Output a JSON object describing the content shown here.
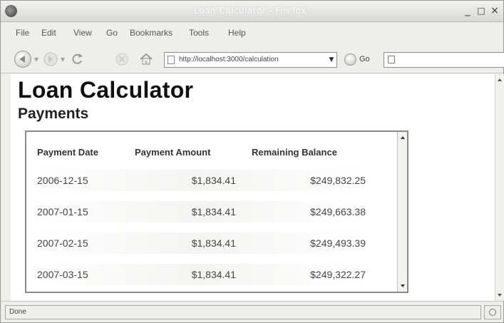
{
  "window": {
    "title": "Loan Calculator - Firefox",
    "controls": {
      "minimize": "_",
      "maximize": "□",
      "close": "×"
    }
  },
  "menu": {
    "items": [
      {
        "label": "File"
      },
      {
        "label": "Edit"
      },
      {
        "label": "View"
      },
      {
        "label": "Go"
      },
      {
        "label": "Bookmarks"
      },
      {
        "label": "Tools"
      },
      {
        "label": "Help"
      }
    ]
  },
  "toolbar": {
    "url": "http://localhost:3000/calculation",
    "go_label": "Go",
    "search_value": ""
  },
  "page": {
    "title": "Loan Calculator",
    "section_title": "Payments"
  },
  "payments": {
    "headers": [
      "Payment Date",
      "Payment Amount",
      "Remaining Balance"
    ],
    "rows": [
      {
        "date": "2006-12-15",
        "amount": "$1,834.41",
        "balance": "$249,832.25"
      },
      {
        "date": "2007-01-15",
        "amount": "$1,834.41",
        "balance": "$249,663.38"
      },
      {
        "date": "2007-02-15",
        "amount": "$1,834.41",
        "balance": "$249,493.39"
      },
      {
        "date": "2007-03-15",
        "amount": "$1,834.41",
        "balance": "$249,322.27"
      }
    ]
  },
  "status": {
    "text": "Done"
  },
  "icons": {
    "back": "back-arrow-icon",
    "forward": "forward-arrow-icon",
    "reload": "reload-icon",
    "stop": "stop-icon",
    "home": "home-icon",
    "go": "go-arrow-icon",
    "search": "search-engine-icon"
  }
}
